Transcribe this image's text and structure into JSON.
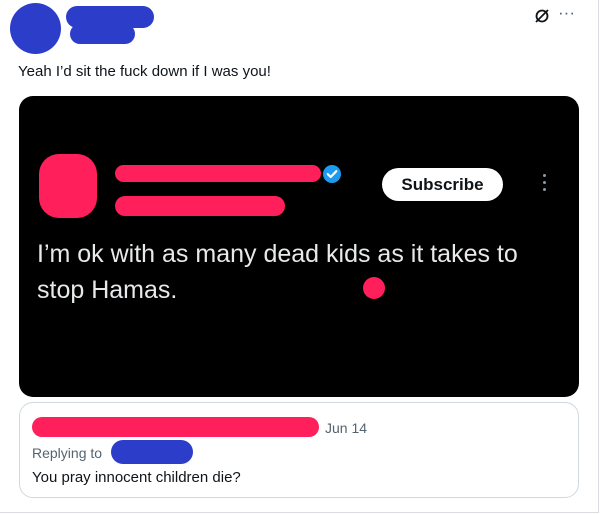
{
  "post": {
    "text": "Yeah I’d sit the fuck down if I was you!",
    "more_icon": "more-horizontal-icon",
    "grok_icon": "grok-icon"
  },
  "media": {
    "subscribe_label": "Subscribe",
    "quote_text": "I’m ok with as many dead kids as it takes to stop Hamas.",
    "verified_icon": "verified-badge-icon",
    "more_icon": "more-vertical-icon"
  },
  "quoted_reply": {
    "date": "Jun 14",
    "replying_to_label": "Replying to",
    "text": "You pray innocent children die?"
  },
  "colors": {
    "redaction_blue": "#2c3ec9",
    "redaction_pink": "#ff1f5a",
    "media_background": "#000000",
    "verified_blue": "#1d9bf0"
  }
}
